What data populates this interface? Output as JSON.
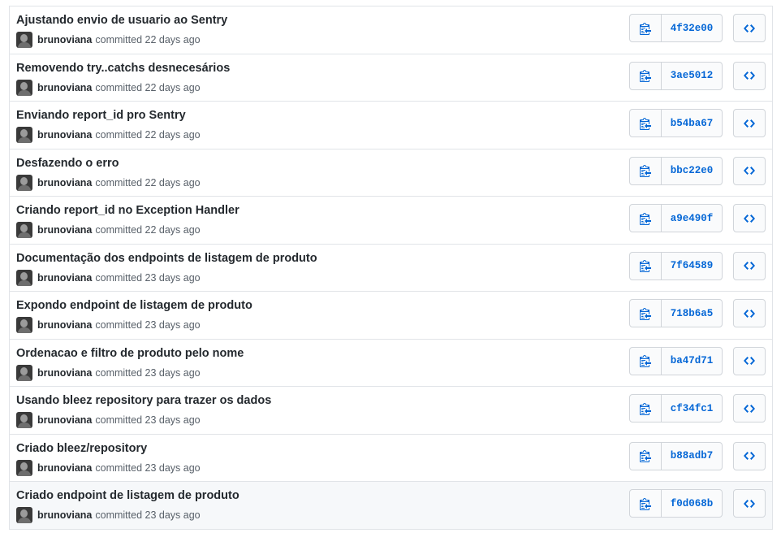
{
  "commits": [
    {
      "message": "Ajustando envio de usuario ao Sentry",
      "author": "brunoviana",
      "time": "committed 22 days ago",
      "sha": "4f32e00"
    },
    {
      "message": "Removendo try..catchs desnecesários",
      "author": "brunoviana",
      "time": "committed 22 days ago",
      "sha": "3ae5012"
    },
    {
      "message": "Enviando report_id pro Sentry",
      "author": "brunoviana",
      "time": "committed 22 days ago",
      "sha": "b54ba67"
    },
    {
      "message": "Desfazendo o erro",
      "author": "brunoviana",
      "time": "committed 22 days ago",
      "sha": "bbc22e0"
    },
    {
      "message": "Criando report_id no Exception Handler",
      "author": "brunoviana",
      "time": "committed 22 days ago",
      "sha": "a9e490f"
    },
    {
      "message": "Documentação dos endpoints de listagem de produto",
      "author": "brunoviana",
      "time": "committed 23 days ago",
      "sha": "7f64589"
    },
    {
      "message": "Expondo endpoint de listagem de produto",
      "author": "brunoviana",
      "time": "committed 23 days ago",
      "sha": "718b6a5"
    },
    {
      "message": "Ordenacao e filtro de produto pelo nome",
      "author": "brunoviana",
      "time": "committed 23 days ago",
      "sha": "ba47d71"
    },
    {
      "message": "Usando bleez repository para trazer os dados",
      "author": "brunoviana",
      "time": "committed 23 days ago",
      "sha": "cf34fc1"
    },
    {
      "message": "Criado bleez/repository",
      "author": "brunoviana",
      "time": "committed 23 days ago",
      "sha": "b88adb7"
    },
    {
      "message": "Criado endpoint de listagem de produto",
      "author": "brunoviana",
      "time": "committed 23 days ago",
      "sha": "f0d068b"
    }
  ],
  "icons": {
    "copy": "clipboard-icon",
    "browse": "code-icon"
  },
  "colors": {
    "sha_link": "#0366d6",
    "hover_row": "#f6f8fa",
    "border": "#e1e4e8"
  }
}
